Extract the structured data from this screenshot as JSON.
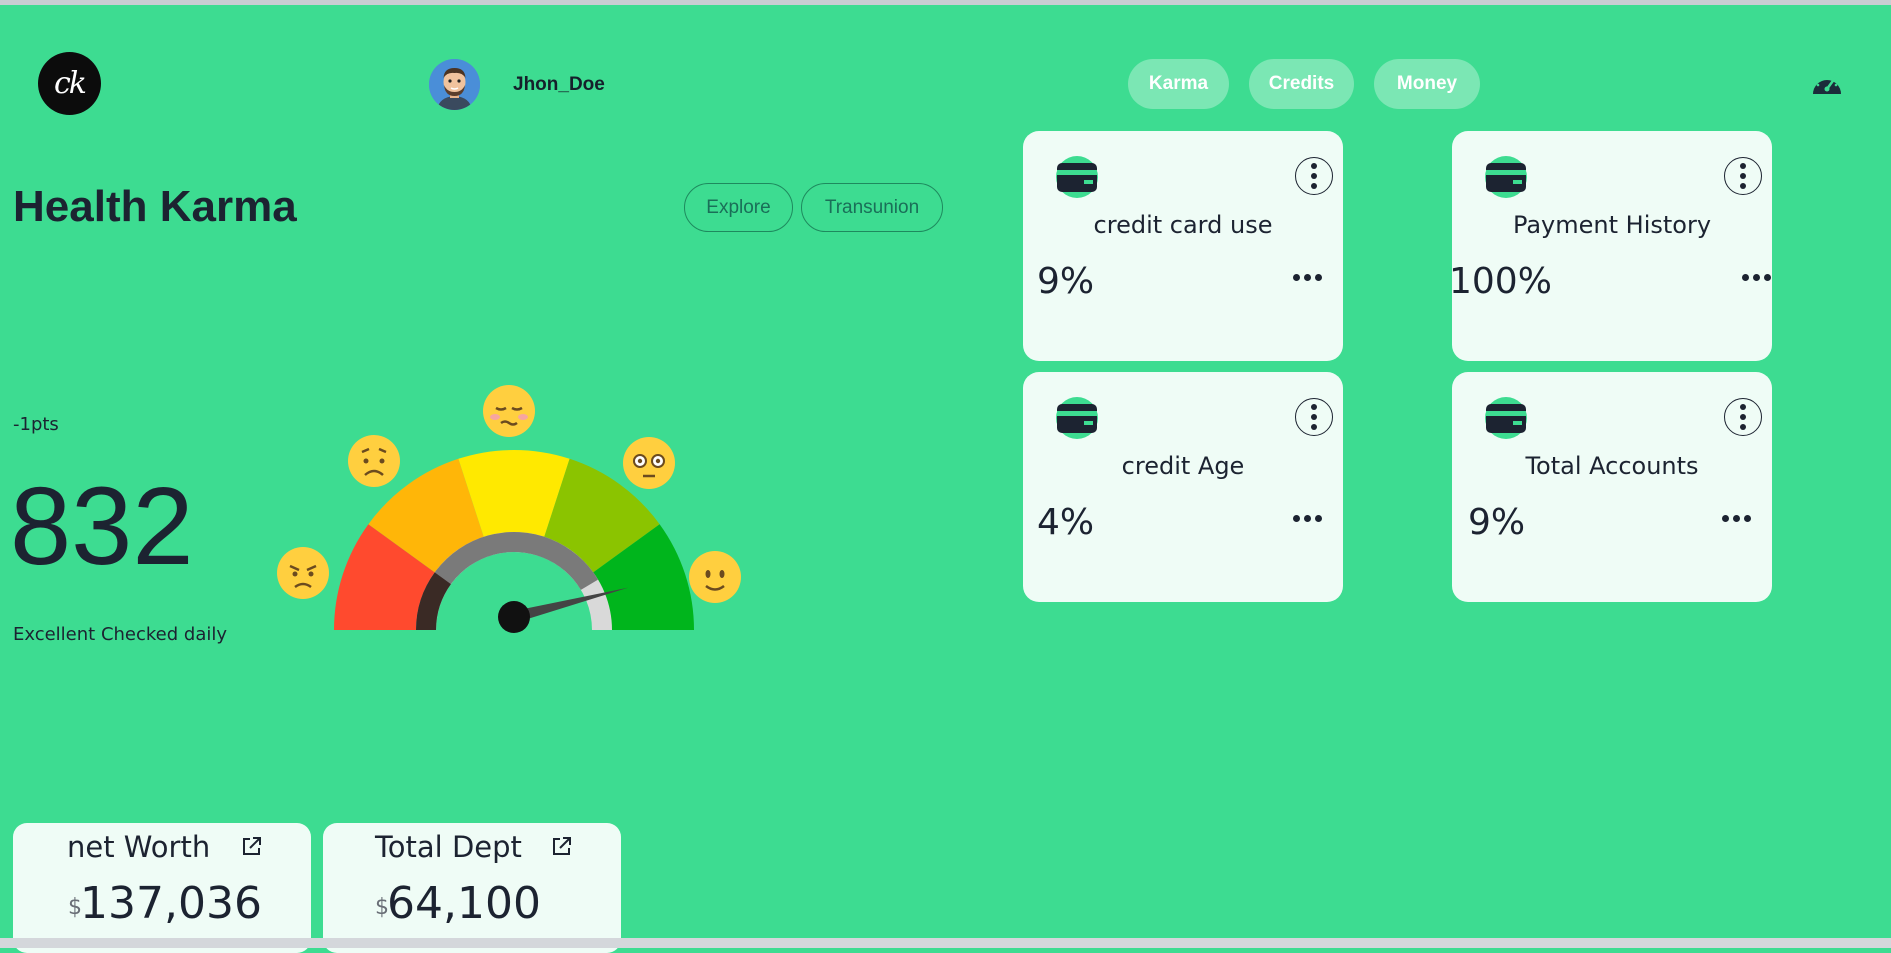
{
  "header": {
    "logo_text": "ck",
    "username": "Jhon_Doe",
    "nav": [
      "Karma",
      "Credits",
      "Money"
    ],
    "right_icon": "speedometer-icon"
  },
  "main": {
    "title": "Health Karma",
    "buttons": [
      "Explore",
      "Transunion"
    ],
    "points_change": "-1pts",
    "score": "832",
    "score_caption": "Excellent Checked daily",
    "gauge": {
      "segments": [
        "#ff4a2e",
        "#ffb608",
        "#ffe900",
        "#8bc400",
        "#00b51c"
      ],
      "needle_level": 0.92,
      "emojis": [
        "angry-face-icon",
        "worried-face-icon",
        "unamused-face-icon",
        "flushed-face-icon",
        "smiling-face-icon"
      ]
    }
  },
  "cards": [
    {
      "icon": "credit-card-icon",
      "title": "credit card use",
      "value": "9%"
    },
    {
      "icon": "credit-card-icon",
      "title": "Payment History",
      "value": "100%"
    },
    {
      "icon": "credit-card-icon",
      "title": "credit Age",
      "value": "4%"
    },
    {
      "icon": "credit-card-icon",
      "title": "Total Accounts",
      "value": "9%"
    }
  ],
  "stats": [
    {
      "label": "net Worth",
      "currency": "$",
      "value": "137,036",
      "icon": "external-link-icon"
    },
    {
      "label": "Total Dept",
      "currency": "$",
      "value": "64,100",
      "icon": "external-link-icon"
    }
  ],
  "colors": {
    "background": "#3ddc91",
    "card": "#effcf6",
    "text": "#1c2331"
  }
}
